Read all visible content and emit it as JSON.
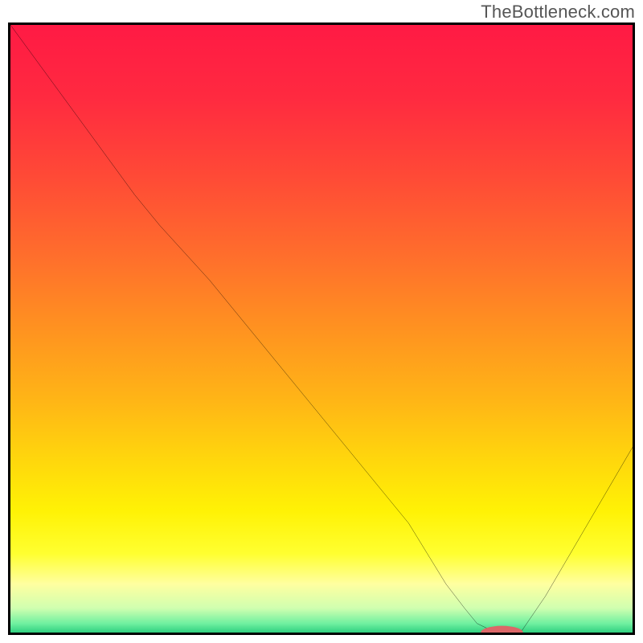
{
  "watermark": {
    "text": "TheBottleneck.com"
  },
  "colors": {
    "border": "#000000",
    "curve": "#000000",
    "marker_fill": "#dc6768",
    "gradient_stops": [
      {
        "offset": 0.0,
        "color": "#ff1a44"
      },
      {
        "offset": 0.12,
        "color": "#ff2a40"
      },
      {
        "offset": 0.25,
        "color": "#ff4a36"
      },
      {
        "offset": 0.38,
        "color": "#ff6e2c"
      },
      {
        "offset": 0.5,
        "color": "#ff9220"
      },
      {
        "offset": 0.62,
        "color": "#ffb616"
      },
      {
        "offset": 0.72,
        "color": "#ffd80c"
      },
      {
        "offset": 0.8,
        "color": "#fff205"
      },
      {
        "offset": 0.87,
        "color": "#ffff30"
      },
      {
        "offset": 0.92,
        "color": "#ffffa0"
      },
      {
        "offset": 0.96,
        "color": "#d0ffb0"
      },
      {
        "offset": 0.985,
        "color": "#70f0a0"
      },
      {
        "offset": 1.0,
        "color": "#30d080"
      }
    ]
  },
  "chart_data": {
    "type": "line",
    "title": "",
    "xlabel": "",
    "ylabel": "",
    "xlim": [
      0,
      100
    ],
    "ylim": [
      0,
      100
    ],
    "x": [
      0,
      5,
      10,
      15,
      20,
      24,
      28,
      32,
      36,
      40,
      44,
      48,
      52,
      56,
      60,
      64,
      67,
      70,
      73,
      75,
      78,
      82,
      86,
      90,
      94,
      98,
      100
    ],
    "values": [
      100,
      93,
      86,
      79,
      72,
      67,
      62.5,
      58,
      53,
      48,
      43,
      38,
      33,
      28,
      23,
      18,
      13,
      8,
      4,
      1.5,
      0,
      0,
      6,
      13,
      20,
      27,
      30.5
    ],
    "marker": {
      "x": 79,
      "y": 0,
      "rx": 3.4,
      "ry": 1.1
    },
    "legend": null,
    "annotations": []
  }
}
